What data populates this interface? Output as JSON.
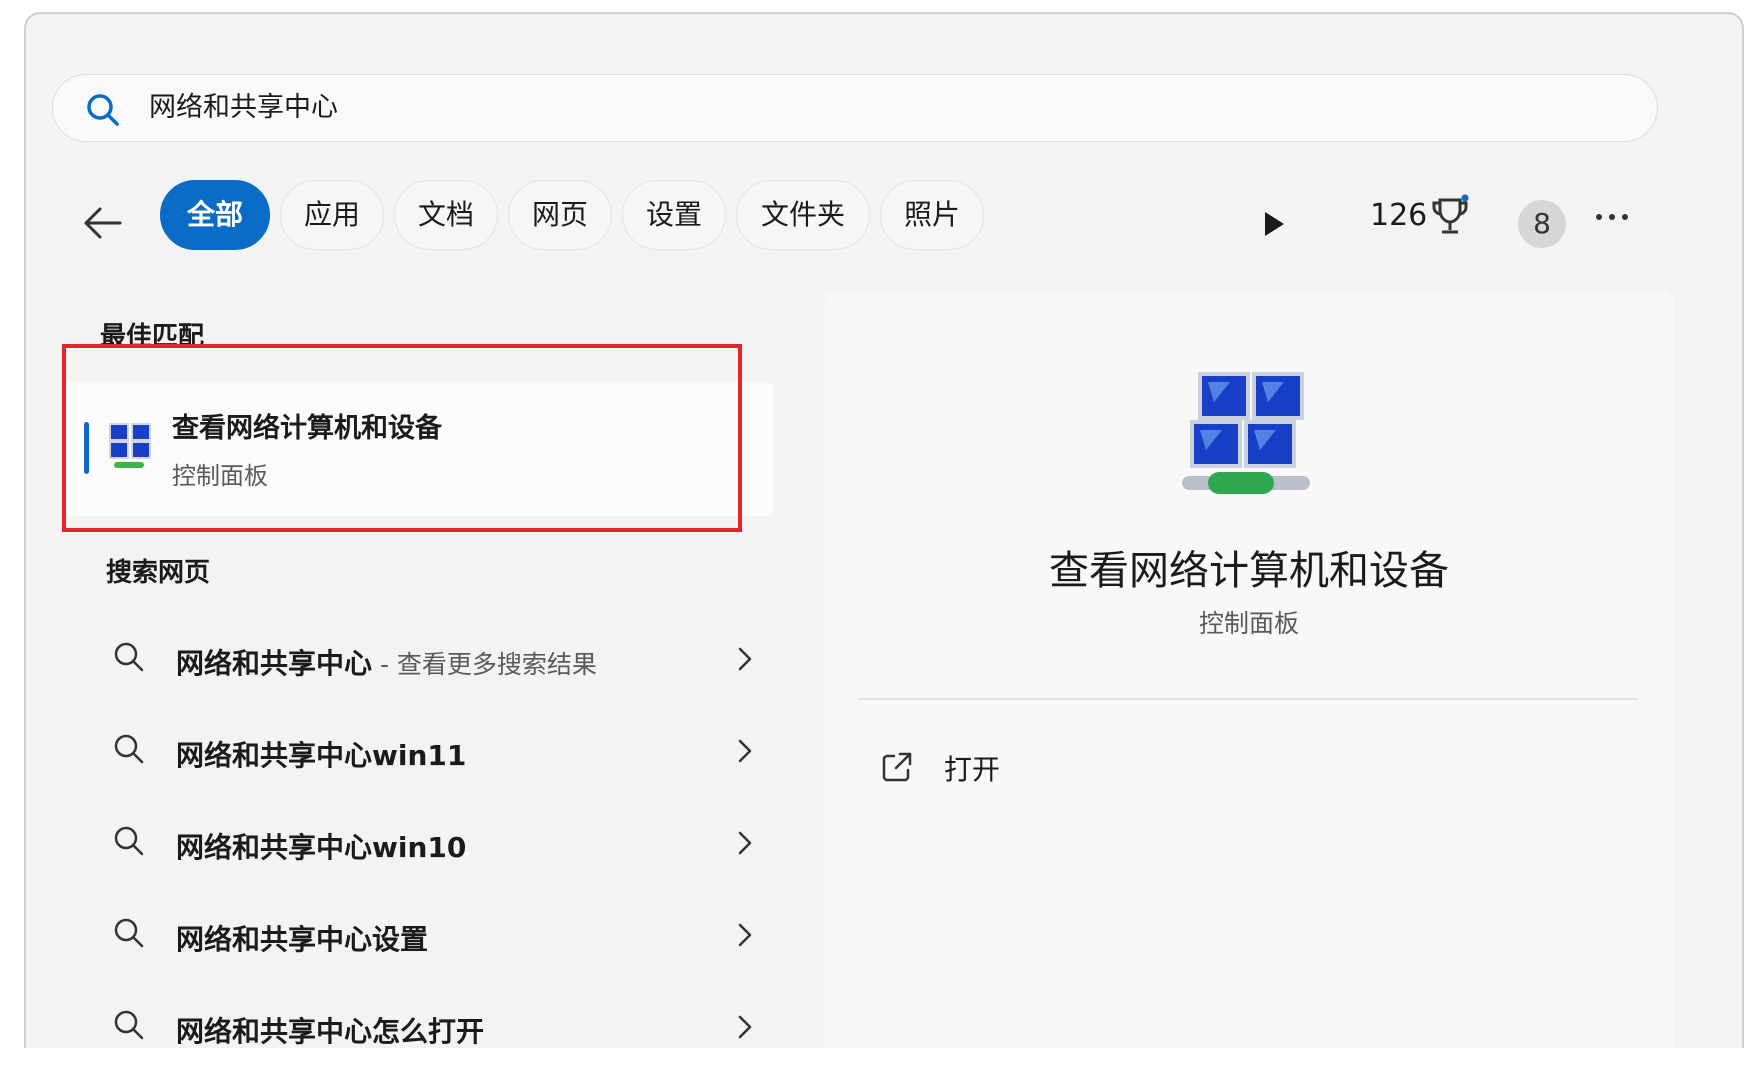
{
  "search": {
    "query": "网络和共享中心"
  },
  "filters": {
    "chips": [
      "全部",
      "应用",
      "文档",
      "网页",
      "设置",
      "文件夹",
      "照片"
    ],
    "active_index": 0
  },
  "header": {
    "points": "126",
    "avatar_initial": "8"
  },
  "best_match": {
    "section_title": "最佳匹配",
    "title": "查看网络计算机和设备",
    "subtitle": "控制面板"
  },
  "web_search": {
    "section_title": "搜索网页",
    "results": [
      {
        "text": "网络和共享中心",
        "suffix": " - 查看更多搜索结果"
      },
      {
        "text": "网络和共享中心win11",
        "suffix": ""
      },
      {
        "text": "网络和共享中心win10",
        "suffix": ""
      },
      {
        "text": "网络和共享中心设置",
        "suffix": ""
      },
      {
        "text": "网络和共享中心怎么打开",
        "suffix": ""
      }
    ]
  },
  "detail": {
    "title": "查看网络计算机和设备",
    "subtitle": "控制面板",
    "actions": [
      {
        "label": "打开",
        "icon": "open-external-icon"
      }
    ]
  },
  "colors": {
    "accent": "#0a6cc7",
    "highlight_box": "#e5242c"
  }
}
